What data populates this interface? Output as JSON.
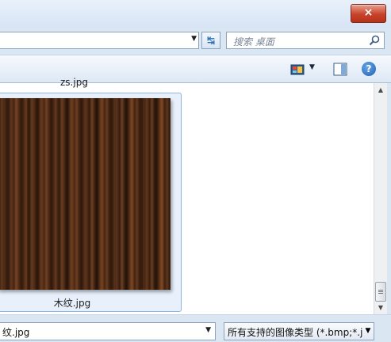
{
  "titlebar": {
    "close_label": "×"
  },
  "address": {
    "dropdown_icon": "chevron-down-icon",
    "refresh_icon": "refresh-arrows-icon",
    "refresh_glyph": "↹"
  },
  "search": {
    "placeholder": "搜索 桌面",
    "icon": "search-icon"
  },
  "toolbar": {
    "view_icon": "change-view-icon",
    "view_dropdown_glyph": "▼",
    "preview_icon": "preview-pane-icon",
    "help_glyph": "?"
  },
  "content": {
    "items": [
      {
        "label": "zs.jpg"
      },
      {
        "label": "木纹.jpg",
        "selected": true,
        "thumbnail": "dark wood grain texture"
      }
    ]
  },
  "scrollbar": {
    "up_glyph": "▲",
    "down_glyph": "▼"
  },
  "bottom": {
    "filename_value": "纹.jpg",
    "dropdown_glyph": "▼",
    "filetype_value": "所有支持的图像类型 (*.bmp;*.j",
    "filetype_arrow_glyph": "▼"
  },
  "colors": {
    "window_frame": "#dbe6f3",
    "selection_fill": "#e8f1fb",
    "selection_border": "#8fb5e2",
    "close_button": "#c8432b",
    "wood_dark": "#3a1e0e",
    "wood_light": "#6b3a1c"
  }
}
